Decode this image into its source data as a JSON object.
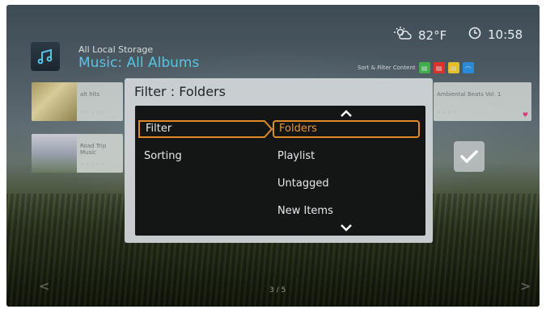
{
  "header": {
    "source": "All Local Storage",
    "breadcrumb": "Music: All Albums",
    "temperature": "82°F",
    "time": "10:58",
    "sort_filter_label": "Sort & Filter Content",
    "sort_chips": [
      {
        "icon": "green-chip-icon",
        "color": "#3fae4a"
      },
      {
        "icon": "red-chip-icon",
        "color": "#d9342b"
      },
      {
        "icon": "yellow-chip-icon",
        "color": "#e2c02a"
      },
      {
        "icon": "blue-chip-icon",
        "color": "#2a8ad6"
      }
    ]
  },
  "tiles": [
    {
      "name": "alt hits"
    },
    {
      "name": "Road Trip Music"
    },
    {
      "name": "Ambiental Beats Vol. 1"
    }
  ],
  "dialog": {
    "title": "Filter : Folders",
    "left_items": [
      {
        "label": "Filter",
        "active": true
      },
      {
        "label": "Sorting",
        "active": false
      }
    ],
    "right_items": [
      {
        "label": "Folders",
        "selected": true
      },
      {
        "label": "Playlist",
        "selected": false
      },
      {
        "label": "Untagged",
        "selected": false
      },
      {
        "label": "New Items",
        "selected": false
      }
    ]
  },
  "pager": "3 / 5",
  "colors": {
    "accent": "#e08a2a",
    "breadcrumb": "#57c4e6"
  }
}
